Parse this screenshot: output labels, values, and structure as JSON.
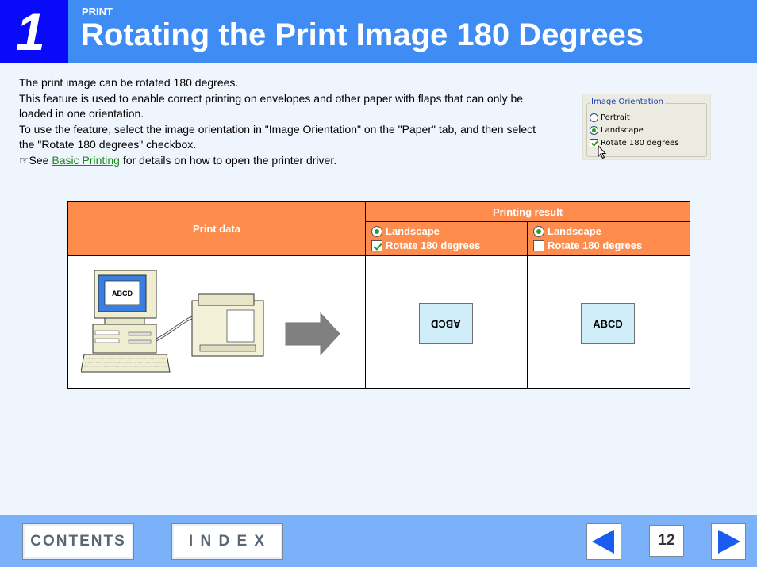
{
  "header": {
    "chapter_number": "1",
    "section_label": "PRINT",
    "title": "Rotating the Print Image 180 Degrees"
  },
  "intro": {
    "line1": "The print image can be rotated 180 degrees.",
    "line2": "This feature is used to enable correct printing on envelopes and other paper with flaps that can only be loaded in one orientation.",
    "line3": "To use the feature, select the image orientation in \"Image Orientation\" on the \"Paper\" tab, and then select the \"Rotate 180 degrees\" checkbox.",
    "see_prefix": "☞See ",
    "link_text": "Basic Printing",
    "see_suffix": " for details on how to open the printer driver."
  },
  "dialog": {
    "legend": "Image Orientation",
    "options": [
      "Portrait",
      "Landscape"
    ],
    "checkbox_label": "Rotate 180 degrees",
    "selected": "Landscape",
    "rotate_checked": true
  },
  "table": {
    "col1_header": "Print data",
    "col2_header": "Printing result",
    "result_a": {
      "orientation": "Landscape",
      "rotate": "Rotate 180 degrees",
      "checked": true,
      "sample": "ABCD"
    },
    "result_b": {
      "orientation": "Landscape",
      "rotate": "Rotate 180 degrees",
      "checked": false,
      "sample": "ABCD"
    },
    "monitor_text": "ABCD"
  },
  "footer": {
    "contents_label": "CONTENTS",
    "index_label": "I N D E X",
    "page_number": "12"
  },
  "colors": {
    "header_bg": "#3f8cf4",
    "chapter_bg": "#0a0afa",
    "table_header_bg": "#fe8c4c",
    "footer_bg": "#7ab1f8",
    "arrow_blue": "#1a5cf0"
  }
}
